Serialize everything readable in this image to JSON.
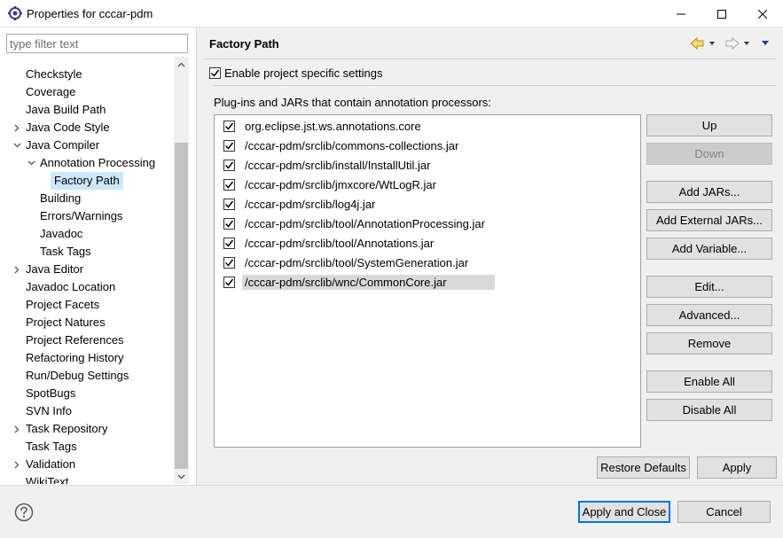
{
  "window": {
    "title": "Properties for cccar-pdm",
    "app_icon": "eclipse-gear-icon"
  },
  "sidebar": {
    "filter_placeholder": "type filter text",
    "items": [
      {
        "label": "Checkstyle",
        "level": 0,
        "expander": "none"
      },
      {
        "label": "Coverage",
        "level": 0,
        "expander": "none"
      },
      {
        "label": "Java Build Path",
        "level": 0,
        "expander": "none"
      },
      {
        "label": "Java Code Style",
        "level": 0,
        "expander": "collapsed"
      },
      {
        "label": "Java Compiler",
        "level": 0,
        "expander": "expanded"
      },
      {
        "label": "Annotation Processing",
        "level": 1,
        "expander": "expanded"
      },
      {
        "label": "Factory Path",
        "level": 2,
        "expander": "none",
        "selected": true
      },
      {
        "label": "Building",
        "level": 1,
        "expander": "none"
      },
      {
        "label": "Errors/Warnings",
        "level": 1,
        "expander": "none"
      },
      {
        "label": "Javadoc",
        "level": 1,
        "expander": "none"
      },
      {
        "label": "Task Tags",
        "level": 1,
        "expander": "none"
      },
      {
        "label": "Java Editor",
        "level": 0,
        "expander": "collapsed"
      },
      {
        "label": "Javadoc Location",
        "level": 0,
        "expander": "none"
      },
      {
        "label": "Project Facets",
        "level": 0,
        "expander": "none"
      },
      {
        "label": "Project Natures",
        "level": 0,
        "expander": "none"
      },
      {
        "label": "Project References",
        "level": 0,
        "expander": "none"
      },
      {
        "label": "Refactoring History",
        "level": 0,
        "expander": "none"
      },
      {
        "label": "Run/Debug Settings",
        "level": 0,
        "expander": "none"
      },
      {
        "label": "SpotBugs",
        "level": 0,
        "expander": "none"
      },
      {
        "label": "SVN Info",
        "level": 0,
        "expander": "none"
      },
      {
        "label": "Task Repository",
        "level": 0,
        "expander": "collapsed"
      },
      {
        "label": "Task Tags",
        "level": 0,
        "expander": "none"
      },
      {
        "label": "Validation",
        "level": 0,
        "expander": "collapsed"
      },
      {
        "label": "WikiText",
        "level": 0,
        "expander": "none"
      }
    ]
  },
  "page": {
    "title": "Factory Path",
    "enable_label": "Enable project specific settings",
    "enable_checked": true,
    "list_caption": "Plug-ins and JARs that contain annotation processors:",
    "jars": [
      {
        "path": "org.eclipse.jst.ws.annotations.core",
        "checked": true
      },
      {
        "path": "/cccar-pdm/srclib/commons-collections.jar",
        "checked": true
      },
      {
        "path": "/cccar-pdm/srclib/install/InstallUtil.jar",
        "checked": true
      },
      {
        "path": "/cccar-pdm/srclib/jmxcore/WtLogR.jar",
        "checked": true
      },
      {
        "path": "/cccar-pdm/srclib/log4j.jar",
        "checked": true
      },
      {
        "path": "/cccar-pdm/srclib/tool/AnnotationProcessing.jar",
        "checked": true
      },
      {
        "path": "/cccar-pdm/srclib/tool/Annotations.jar",
        "checked": true
      },
      {
        "path": "/cccar-pdm/srclib/tool/SystemGeneration.jar",
        "checked": true
      },
      {
        "path": "/cccar-pdm/srclib/wnc/CommonCore.jar",
        "checked": true,
        "selected": true
      }
    ],
    "buttons": {
      "up": "Up",
      "down": "Down",
      "add_jars": "Add JARs...",
      "add_external_jars": "Add External JARs...",
      "add_variable": "Add Variable...",
      "edit": "Edit...",
      "advanced": "Advanced...",
      "remove": "Remove",
      "enable_all": "Enable All",
      "disable_all": "Disable All",
      "restore_defaults": "Restore Defaults",
      "apply": "Apply"
    }
  },
  "footer": {
    "apply_and_close": "Apply and Close",
    "cancel": "Cancel",
    "help_icon": "help-icon"
  },
  "colors": {
    "selection": "#cce8ff",
    "default_button_border": "#0078d7",
    "nav_arrow": "#e8b830"
  }
}
